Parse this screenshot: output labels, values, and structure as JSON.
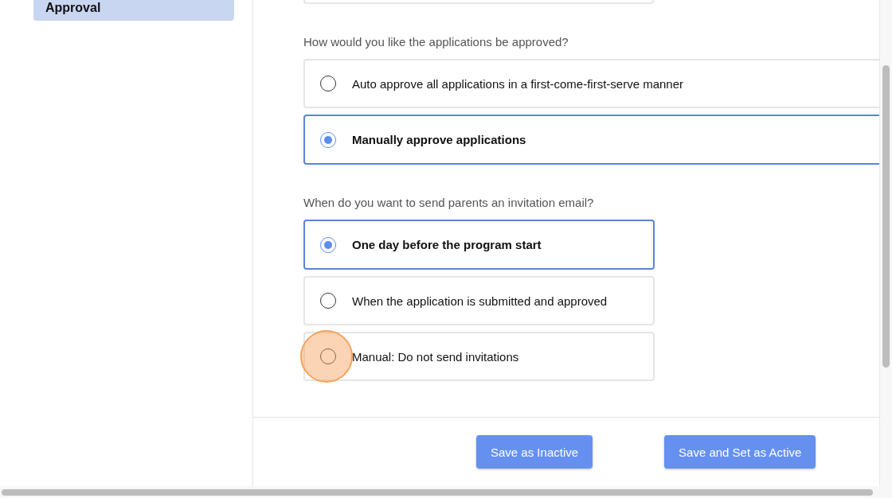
{
  "sidebar": {
    "items": [
      {
        "label": "Approval",
        "selected": true
      }
    ]
  },
  "questions": [
    {
      "prompt": "How would you like the applications be approved?",
      "options": [
        {
          "label": "Auto approve all applications in a first-come-first-serve manner",
          "selected": false
        },
        {
          "label": "Manually approve applications",
          "selected": true
        }
      ]
    },
    {
      "prompt": "When do you want to send parents an invitation email?",
      "options": [
        {
          "label": "One day before the program start",
          "selected": true
        },
        {
          "label": "When the application is submitted and approved",
          "selected": false
        },
        {
          "label": "Manual: Do not send invitations",
          "selected": false
        }
      ]
    }
  ],
  "footer": {
    "buttons": [
      "Save as Inactive",
      "Save and Set as Active"
    ]
  }
}
